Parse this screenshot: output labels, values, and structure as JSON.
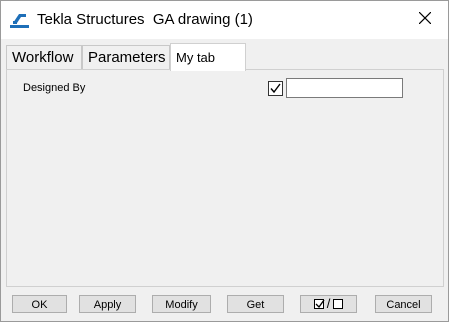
{
  "window": {
    "title": "Tekla Structures  GA drawing (1)",
    "close_icon": "close-icon",
    "app_icon": "tekla-logo-icon"
  },
  "tabs": [
    {
      "label": "Workflow",
      "active": false
    },
    {
      "label": "Parameters",
      "active": false
    },
    {
      "label": "My tab",
      "active": true
    }
  ],
  "form": {
    "designed_by": {
      "label": "Designed By",
      "checked": true,
      "value": ""
    }
  },
  "buttons": {
    "ok": "OK",
    "apply": "Apply",
    "modify": "Modify",
    "get": "Get",
    "toggle_separator": "/",
    "cancel": "Cancel"
  },
  "colors": {
    "accent": "#1e6fb8",
    "background": "#f0f0f0"
  }
}
